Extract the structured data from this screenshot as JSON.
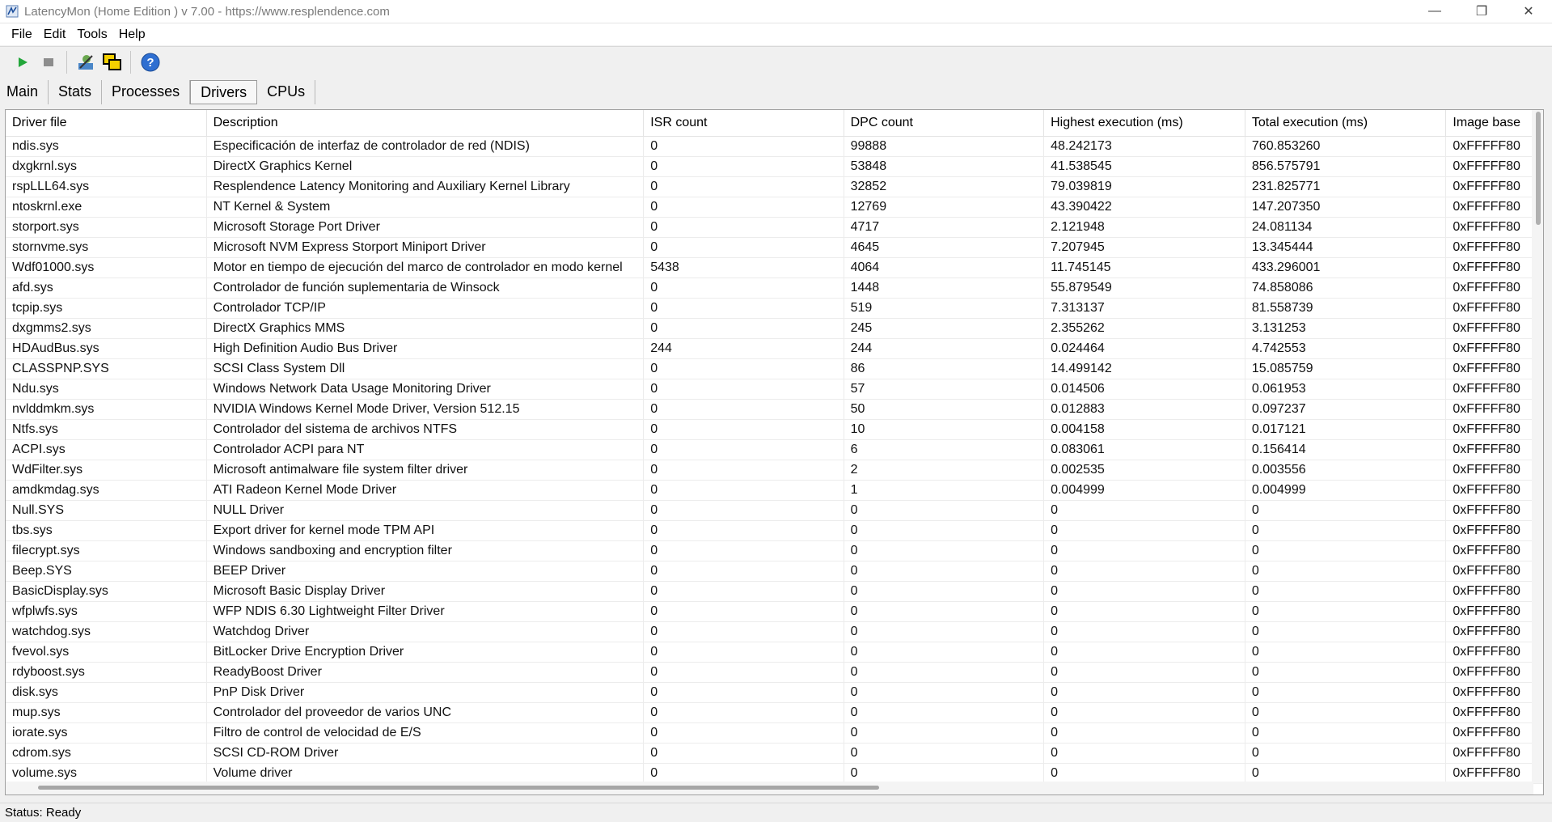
{
  "window": {
    "title": "LatencyMon  (Home Edition )  v 7.00 - https://www.resplendence.com"
  },
  "menu": [
    "File",
    "Edit",
    "Tools",
    "Help"
  ],
  "toolbar": {
    "icons": [
      "play-icon",
      "stop-icon",
      "profile-icon",
      "windows-icon",
      "help-icon"
    ]
  },
  "tabs": [
    {
      "label": "Main",
      "active": false
    },
    {
      "label": "Stats",
      "active": false
    },
    {
      "label": "Processes",
      "active": false
    },
    {
      "label": "Drivers",
      "active": true
    },
    {
      "label": "CPUs",
      "active": false
    }
  ],
  "table": {
    "columns": [
      "Driver file",
      "Description",
      "ISR count",
      "DPC count",
      "Highest execution (ms)",
      "Total execution (ms)",
      "Image base"
    ],
    "rows": [
      [
        "ndis.sys",
        "Especificación de interfaz de controlador de red (NDIS)",
        "0",
        "99888",
        "48.242173",
        "760.853260",
        "0xFFFFF80"
      ],
      [
        "dxgkrnl.sys",
        "DirectX Graphics Kernel",
        "0",
        "53848",
        "41.538545",
        "856.575791",
        "0xFFFFF80"
      ],
      [
        "rspLLL64.sys",
        "Resplendence Latency Monitoring and Auxiliary Kernel Library",
        "0",
        "32852",
        "79.039819",
        "231.825771",
        "0xFFFFF80"
      ],
      [
        "ntoskrnl.exe",
        "NT Kernel & System",
        "0",
        "12769",
        "43.390422",
        "147.207350",
        "0xFFFFF80"
      ],
      [
        "storport.sys",
        "Microsoft Storage Port Driver",
        "0",
        "4717",
        "2.121948",
        "24.081134",
        "0xFFFFF80"
      ],
      [
        "stornvme.sys",
        "Microsoft NVM Express Storport Miniport Driver",
        "0",
        "4645",
        "7.207945",
        "13.345444",
        "0xFFFFF80"
      ],
      [
        "Wdf01000.sys",
        "Motor en tiempo de ejecución del marco de controlador en modo kernel",
        "5438",
        "4064",
        "11.745145",
        "433.296001",
        "0xFFFFF80"
      ],
      [
        "afd.sys",
        "Controlador de función suplementaria de  Winsock",
        "0",
        "1448",
        "55.879549",
        "74.858086",
        "0xFFFFF80"
      ],
      [
        "tcpip.sys",
        "Controlador TCP/IP",
        "0",
        "519",
        "7.313137",
        "81.558739",
        "0xFFFFF80"
      ],
      [
        "dxgmms2.sys",
        "DirectX Graphics MMS",
        "0",
        "245",
        "2.355262",
        "3.131253",
        "0xFFFFF80"
      ],
      [
        "HDAudBus.sys",
        "High Definition Audio Bus Driver",
        "244",
        "244",
        "0.024464",
        "4.742553",
        "0xFFFFF80"
      ],
      [
        "CLASSPNP.SYS",
        "SCSI Class System Dll",
        "0",
        "86",
        "14.499142",
        "15.085759",
        "0xFFFFF80"
      ],
      [
        "Ndu.sys",
        "Windows Network Data Usage Monitoring Driver",
        "0",
        "57",
        "0.014506",
        "0.061953",
        "0xFFFFF80"
      ],
      [
        "nvlddmkm.sys",
        "NVIDIA Windows Kernel Mode Driver, Version 512.15",
        "0",
        "50",
        "0.012883",
        "0.097237",
        "0xFFFFF80"
      ],
      [
        "Ntfs.sys",
        "Controlador del sistema de archivos NTFS",
        "0",
        "10",
        "0.004158",
        "0.017121",
        "0xFFFFF80"
      ],
      [
        "ACPI.sys",
        "Controlador ACPI para NT",
        "0",
        "6",
        "0.083061",
        "0.156414",
        "0xFFFFF80"
      ],
      [
        "WdFilter.sys",
        "Microsoft antimalware file system filter driver",
        "0",
        "2",
        "0.002535",
        "0.003556",
        "0xFFFFF80"
      ],
      [
        "amdkmdag.sys",
        "ATI Radeon Kernel Mode Driver",
        "0",
        "1",
        "0.004999",
        "0.004999",
        "0xFFFFF80"
      ],
      [
        "Null.SYS",
        "NULL Driver",
        "0",
        "0",
        "0",
        "0",
        "0xFFFFF80"
      ],
      [
        "tbs.sys",
        "Export driver for kernel mode TPM API",
        "0",
        "0",
        "0",
        "0",
        "0xFFFFF80"
      ],
      [
        "filecrypt.sys",
        "Windows sandboxing and encryption filter",
        "0",
        "0",
        "0",
        "0",
        "0xFFFFF80"
      ],
      [
        "Beep.SYS",
        "BEEP Driver",
        "0",
        "0",
        "0",
        "0",
        "0xFFFFF80"
      ],
      [
        "BasicDisplay.sys",
        "Microsoft Basic Display Driver",
        "0",
        "0",
        "0",
        "0",
        "0xFFFFF80"
      ],
      [
        "wfplwfs.sys",
        "WFP NDIS 6.30 Lightweight Filter Driver",
        "0",
        "0",
        "0",
        "0",
        "0xFFFFF80"
      ],
      [
        "watchdog.sys",
        "Watchdog Driver",
        "0",
        "0",
        "0",
        "0",
        "0xFFFFF80"
      ],
      [
        "fvevol.sys",
        "BitLocker Drive Encryption Driver",
        "0",
        "0",
        "0",
        "0",
        "0xFFFFF80"
      ],
      [
        "rdyboost.sys",
        "ReadyBoost Driver",
        "0",
        "0",
        "0",
        "0",
        "0xFFFFF80"
      ],
      [
        "disk.sys",
        "PnP Disk Driver",
        "0",
        "0",
        "0",
        "0",
        "0xFFFFF80"
      ],
      [
        "mup.sys",
        "Controlador del proveedor de varios UNC",
        "0",
        "0",
        "0",
        "0",
        "0xFFFFF80"
      ],
      [
        "iorate.sys",
        "Filtro de control de velocidad de E/S",
        "0",
        "0",
        "0",
        "0",
        "0xFFFFF80"
      ],
      [
        "cdrom.sys",
        "SCSI CD-ROM Driver",
        "0",
        "0",
        "0",
        "0",
        "0xFFFFF80"
      ],
      [
        "volume.sys",
        "Volume driver",
        "0",
        "0",
        "0",
        "0",
        "0xFFFFF80"
      ]
    ]
  },
  "status": {
    "text": "Status: Ready"
  }
}
